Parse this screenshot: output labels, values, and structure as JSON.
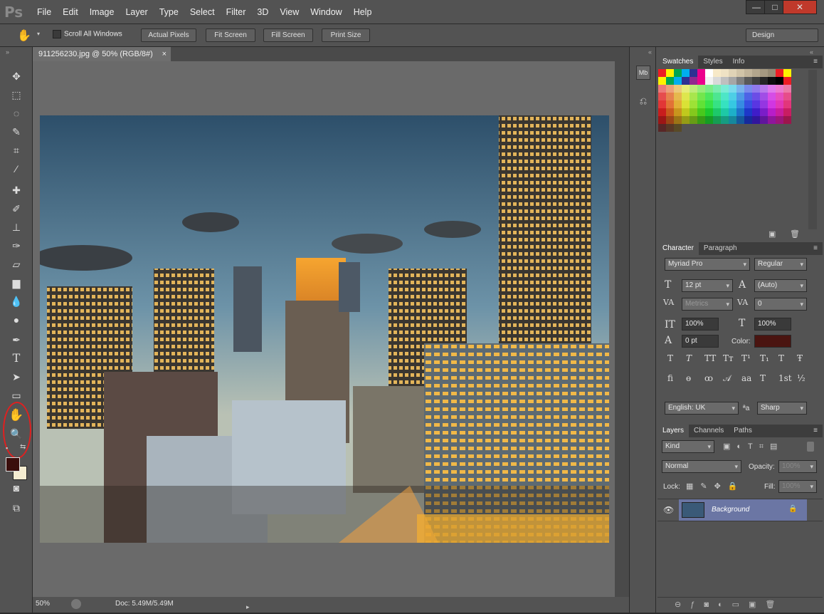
{
  "app": {
    "logo": "Ps"
  },
  "menu": [
    "File",
    "Edit",
    "Image",
    "Layer",
    "Type",
    "Select",
    "Filter",
    "3D",
    "View",
    "Window",
    "Help"
  ],
  "window_controls": {
    "minimize": "—",
    "restore": "□",
    "close": "✕"
  },
  "options": {
    "scroll_all": "Scroll All Windows",
    "buttons": [
      "Actual Pixels",
      "Fit Screen",
      "Fill Screen",
      "Print Size"
    ],
    "workspace": "Design"
  },
  "document": {
    "tab_title": "911256230.jpg @ 50% (RGB/8#)",
    "tab_close": "×",
    "zoom": "50%",
    "doc_info": "Doc: 5.49M/5.49M"
  },
  "swatches_panel": {
    "tabs": [
      "Swatches",
      "Styles",
      "Info"
    ]
  },
  "character_panel": {
    "tabs": [
      "Character",
      "Paragraph"
    ],
    "font_family": "Myriad Pro",
    "font_style": "Regular",
    "size": "12 pt",
    "leading": "(Auto)",
    "kerning": "Metrics",
    "tracking": "0",
    "vscale": "100%",
    "hscale": "100%",
    "baseline": "0 pt",
    "color_label": "Color:",
    "color": "#4a1410",
    "language": "English: UK",
    "antialias": "Sharp",
    "antialias_icon": "ªa"
  },
  "layers_panel": {
    "tabs": [
      "Layers",
      "Channels",
      "Paths"
    ],
    "filter": "Kind",
    "blend": "Normal",
    "opacity_label": "Opacity:",
    "opacity": "100%",
    "lock_label": "Lock:",
    "fill_label": "Fill:",
    "fill": "100%",
    "layer_name": "Background"
  },
  "colors": {
    "foreground": "#3a0e0c",
    "background": "#f4ecd0",
    "highlight": "#e02020"
  }
}
